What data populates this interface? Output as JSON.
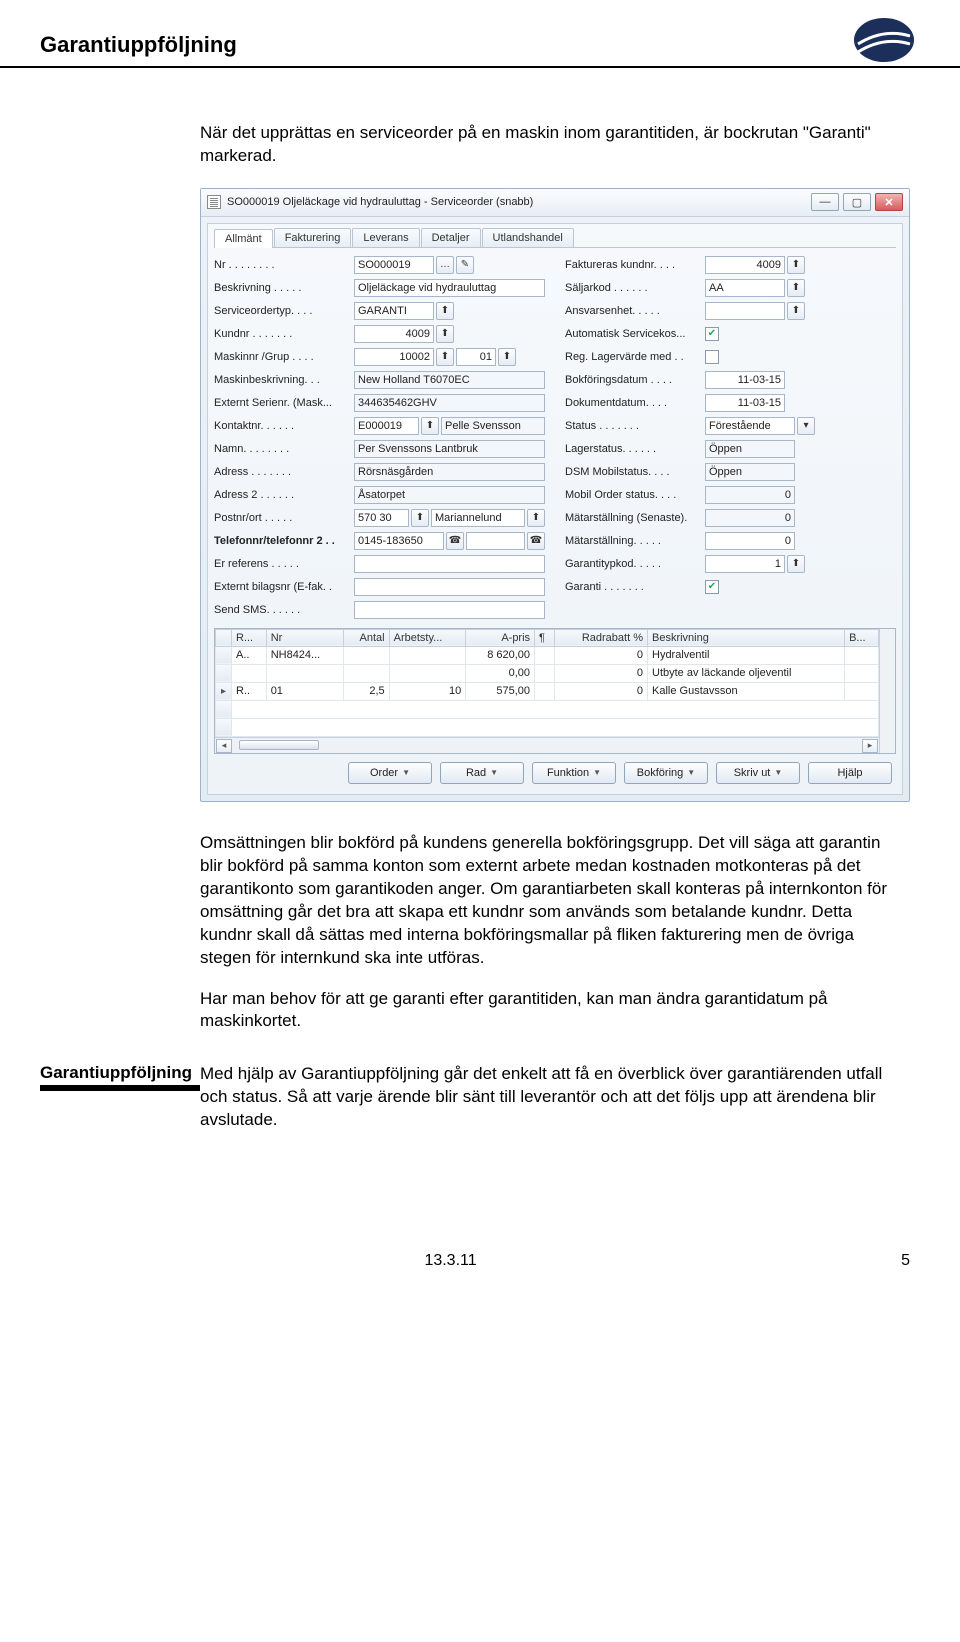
{
  "header": {
    "title": "Garantiuppföljning"
  },
  "intro": "När det upprättas en serviceorder på en maskin inom garantitiden, är bockrutan \"Garanti\" markerad.",
  "app": {
    "window_title": "SO000019 Oljeläckage vid hydrauluttag - Serviceorder (snabb)",
    "tabs": [
      "Allmänt",
      "Fakturering",
      "Leverans",
      "Detaljer",
      "Utlandshandel"
    ],
    "left": {
      "nr": {
        "label": "Nr . . . . . . . .",
        "value": "SO000019"
      },
      "beskrivning": {
        "label": "Beskrivning . . . . .",
        "value": "Oljeläckage vid hydrauluttag"
      },
      "serviceordertyp": {
        "label": "Serviceordertyp. . . .",
        "value": "GARANTI"
      },
      "kundnr": {
        "label": "Kundnr . . . . . . .",
        "value": "4009"
      },
      "maskinnr": {
        "label": "Maskinnr /Grup . . . .",
        "value": "10002",
        "sub": "01"
      },
      "maskinbeskrivning": {
        "label": "Maskinbeskrivning. . .",
        "value": "New Holland T6070EC"
      },
      "externt_serienr": {
        "label": "Externt Serienr. (Mask...",
        "value": "344635462GHV"
      },
      "kontaktnr": {
        "label": "Kontaktnr. . . . . .",
        "value": "E000019",
        "extra": "Pelle Svensson"
      },
      "namn": {
        "label": "Namn. . . . . . . .",
        "value": "Per Svenssons Lantbruk"
      },
      "adress": {
        "label": "Adress . . . . . . .",
        "value": "Rörsnäsgården"
      },
      "adress2": {
        "label": "Adress 2 . . . . . .",
        "value": "Åsatorpet"
      },
      "postnr": {
        "label": "Postnr/ort . . . . .",
        "value": "570 30",
        "ort": "Mariannelund"
      },
      "telefonnr": {
        "label": "Telefonnr/telefonnr 2 . .",
        "value": "0145-183650"
      },
      "erreferens": {
        "label": "Er referens . . . . .",
        "value": ""
      },
      "externt_bilagsnr": {
        "label": "Externt bilagsnr (E-fak. .",
        "value": ""
      },
      "send_sms": {
        "label": "Send SMS. . . . . .",
        "value": ""
      }
    },
    "right": {
      "faktureras": {
        "label": "Faktureras kundnr. . . .",
        "value": "4009"
      },
      "saljarkod": {
        "label": "Säljarkod . . . . . .",
        "value": "AA"
      },
      "ansvarsenhet": {
        "label": "Ansvarsenhet. . . . .",
        "value": ""
      },
      "autoservicekos": {
        "label": "Automatisk Servicekos...",
        "checked": true
      },
      "reglager": {
        "label": "Reg. Lagervärde med . .",
        "checked": false
      },
      "bokforingsdatum": {
        "label": "Bokföringsdatum . . . .",
        "value": "11-03-15"
      },
      "dokumentdatum": {
        "label": "Dokumentdatum. . . .",
        "value": "11-03-15"
      },
      "status": {
        "label": "Status . . . . . . .",
        "value": "Förestående"
      },
      "lagerstatus": {
        "label": "Lagerstatus. . . . . .",
        "value": "Öppen"
      },
      "dsm_mobilstatus": {
        "label": "DSM Mobilstatus. . . .",
        "value": "Öppen"
      },
      "mobilorder": {
        "label": "Mobil Order status. . . .",
        "value": "0"
      },
      "matarstallning_senaste": {
        "label": "Mätarställning (Senaste).",
        "value": "0"
      },
      "matarstallning": {
        "label": "Mätarställning. . . . .",
        "value": "0"
      },
      "garantitypkod": {
        "label": "Garantitypkod. . . . .",
        "value": "1"
      },
      "garanti": {
        "label": "Garanti . . . . . . .",
        "checked": true
      }
    },
    "grid": {
      "headers": [
        "R...",
        "Nr",
        "Antal",
        "Arbetsty...",
        "A-pris",
        "¶",
        "Radrabatt %",
        "Beskrivning",
        "B..."
      ],
      "rows": [
        {
          "type": "A..",
          "nr": "NH8424...",
          "antal": "",
          "arbetsty": "",
          "apris": "8 620,00",
          "radrabatt": "0",
          "beskrivning": "Hydralventil"
        },
        {
          "type": "",
          "nr": "",
          "antal": "",
          "arbetsty": "",
          "apris": "0,00",
          "radrabatt": "0",
          "beskrivning": "Utbyte av läckande oljeventil"
        },
        {
          "type": "R..",
          "nr": "01",
          "antal": "2,5",
          "arbetsty": "10",
          "apris": "575,00",
          "radrabatt": "0",
          "beskrivning": "Kalle Gustavsson"
        }
      ]
    },
    "buttons": [
      "Order",
      "Rad",
      "Funktion",
      "Bokföring",
      "Skriv ut",
      "Hjälp"
    ]
  },
  "body_paragraphs": [
    "Omsättningen blir bokförd på kundens generella bokföringsgrupp. Det vill säga att garantin blir bokförd på samma konton som externt arbete medan kostnaden motkonteras på det garantikonto som garantikoden anger. Om garantiarbeten skall konteras på internkonton för omsättning går det bra att skapa ett kundnr som används som betalande kundnr. Detta kundnr skall då sättas med interna bokföringsmallar på fliken fakturering men de övriga stegen för internkund ska inte utföras.",
    "Har man behov för att ge garanti efter garantitiden, kan man ändra garantidatum på maskinkortet."
  ],
  "section": {
    "heading": "Garantiuppföljning",
    "body": "Med hjälp av Garantiuppföljning går det enkelt att få en överblick över garantiärenden utfall och status. Så att varje ärende blir sänt till leverantör och att det följs upp att ärendena blir avslutade."
  },
  "footer": {
    "version": "13.3.11",
    "page": "5"
  }
}
